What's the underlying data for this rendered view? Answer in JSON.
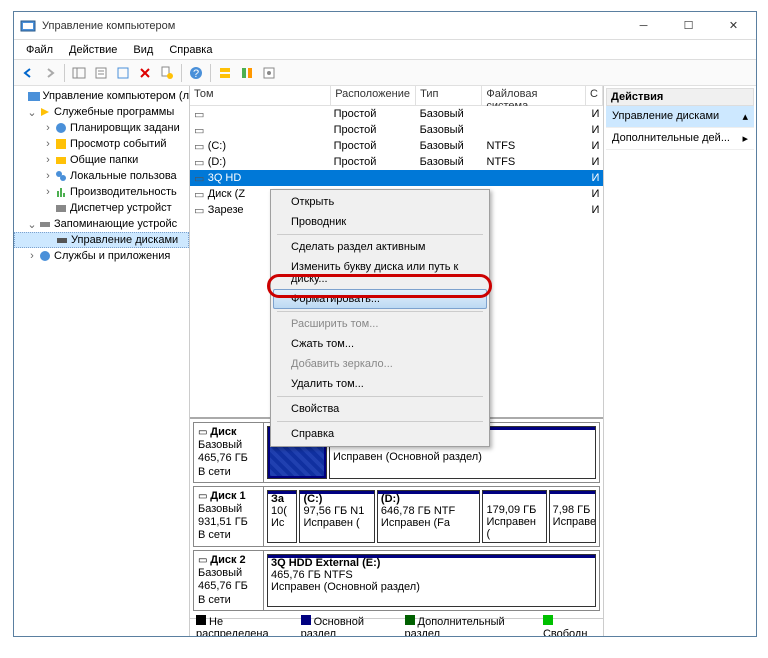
{
  "titlebar": {
    "title": "Управление компьютером"
  },
  "menu": {
    "file": "Файл",
    "action": "Действие",
    "view": "Вид",
    "help": "Справка"
  },
  "tree": {
    "root": "Управление компьютером (л",
    "services_group": "Служебные программы",
    "items": [
      "Планировщик задани",
      "Просмотр событий",
      "Общие папки",
      "Локальные пользова",
      "Производительность",
      "Диспетчер устройст"
    ],
    "storage_group": "Запоминающие устройс",
    "disk_mgmt": "Управление дисками",
    "services_apps": "Службы и приложения"
  },
  "vol_headers": {
    "vol": "Том",
    "layout": "Расположение",
    "type": "Тип",
    "fs": "Файловая система",
    "status": "С"
  },
  "volumes": [
    {
      "name": "",
      "layout": "Простой",
      "type": "Базовый",
      "fs": "",
      "st": "И"
    },
    {
      "name": "",
      "layout": "Простой",
      "type": "Базовый",
      "fs": "",
      "st": "И"
    },
    {
      "name": "(C:)",
      "layout": "Простой",
      "type": "Базовый",
      "fs": "NTFS",
      "st": "И"
    },
    {
      "name": "(D:)",
      "layout": "Простой",
      "type": "Базовый",
      "fs": "NTFS",
      "st": "И"
    },
    {
      "name": "3Q HD",
      "layout": "",
      "type": "",
      "fs": "",
      "st": "И"
    },
    {
      "name": "Диск (Z",
      "layout": "",
      "type": "",
      "fs": "",
      "st": "И"
    },
    {
      "name": "Зарезе",
      "layout": "",
      "type": "",
      "fs": "",
      "st": "И"
    }
  ],
  "disks": [
    {
      "label": "Диск",
      "type": "Базовый",
      "size": "465,76 ГБ",
      "status": "В сети",
      "parts": [
        {
          "name": "",
          "size": "",
          "status": "Исправен (Основной раздел)",
          "cls": "primary",
          "w": 1,
          "pre": true
        }
      ]
    },
    {
      "label": "Диск 1",
      "type": "Базовый",
      "size": "931,51 ГБ",
      "status": "В сети",
      "parts": [
        {
          "name": "За",
          "size": "10(",
          "status": "Ис",
          "cls": "primary",
          "w": 0.08
        },
        {
          "name": "(C:)",
          "size": "97,56 ГБ N1",
          "status": "Исправен (",
          "cls": "primary",
          "w": 0.24
        },
        {
          "name": "(D:)",
          "size": "646,78 ГБ NTF",
          "status": "Исправен (Fa",
          "cls": "primary",
          "w": 0.34
        },
        {
          "name": "",
          "size": "179,09 ГБ",
          "status": "Исправен (",
          "cls": "primary",
          "w": 0.2
        },
        {
          "name": "",
          "size": "7,98 ГБ",
          "status": "Исправе",
          "cls": "primary",
          "w": 0.14
        }
      ]
    },
    {
      "label": "Диск 2",
      "type": "Базовый",
      "size": "465,76 ГБ",
      "status": "В сети",
      "parts": [
        {
          "name": "3Q HDD External  (E:)",
          "size": "465,76 ГБ NTFS",
          "status": "Исправен (Основной раздел)",
          "cls": "primary",
          "w": 1
        }
      ]
    }
  ],
  "legend": {
    "unalloc": "Не распределена",
    "primary": "Основной раздел",
    "ext": "Дополнительный раздел",
    "free": "Свободн"
  },
  "actions": {
    "header": "Действия",
    "disk_mgmt": "Управление дисками",
    "more": "Дополнительные дей..."
  },
  "ctx": {
    "open": "Открыть",
    "explorer": "Проводник",
    "active": "Сделать раздел активным",
    "change_letter": "Изменить букву диска или путь к диску...",
    "format": "Форматировать...",
    "extend": "Расширить том...",
    "shrink": "Сжать том...",
    "mirror": "Добавить зеркало...",
    "delete": "Удалить том...",
    "properties": "Свойства",
    "help": "Справка"
  }
}
